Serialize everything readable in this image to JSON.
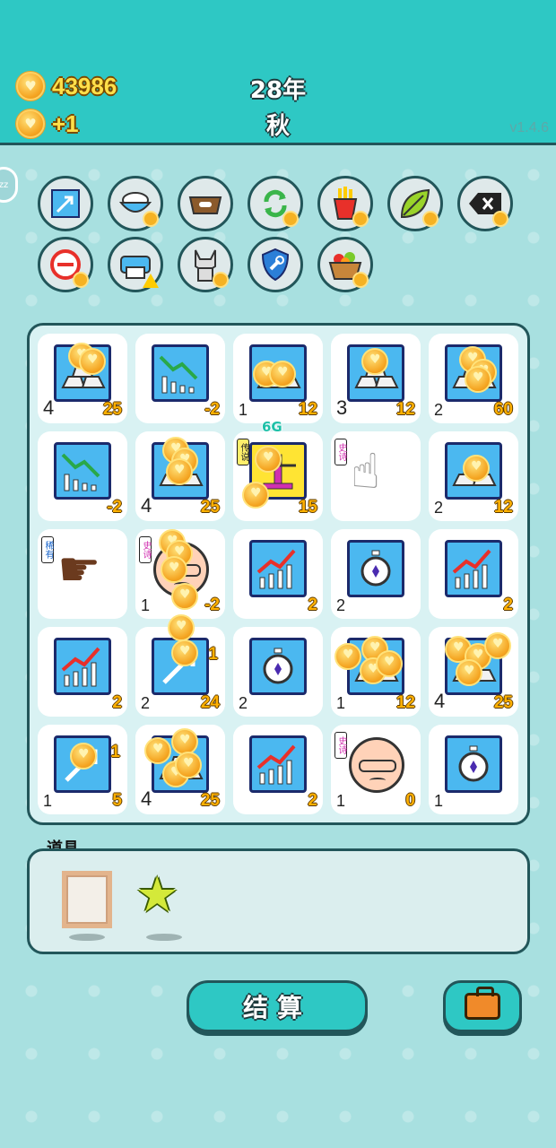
{
  "header": {
    "coins": "43986",
    "income": "+1",
    "year": "28年",
    "season": "秋",
    "version": "v1.4.6"
  },
  "side_tab": "zz",
  "skills_row1": [
    {
      "icon": "arrow-up-right-icon"
    },
    {
      "icon": "rice-bowl-icon"
    },
    {
      "icon": "dog-food-icon"
    },
    {
      "icon": "refresh-icon"
    },
    {
      "icon": "fries-icon"
    },
    {
      "icon": "leaf-icon"
    },
    {
      "icon": "delete-key-icon"
    }
  ],
  "skills_row2": [
    {
      "icon": "minus-circle-icon"
    },
    {
      "icon": "printer-icon"
    },
    {
      "icon": "dog-icon"
    },
    {
      "icon": "wrench-shield-icon"
    },
    {
      "icon": "fruit-basket-icon"
    }
  ],
  "board": [
    [
      {
        "icon": "silver-bars-icon",
        "count": "4",
        "value": "25"
      },
      {
        "icon": "chart-down-icon",
        "count": "",
        "value": "-2"
      },
      {
        "icon": "silver-bars-icon",
        "count": "1",
        "value": "12"
      },
      {
        "icon": "silver-bars-icon",
        "count": "3",
        "value": "12"
      },
      {
        "icon": "silver-bars-icon",
        "count": "2",
        "value": "60"
      }
    ],
    [
      {
        "icon": "chart-down-icon",
        "count": "",
        "value": "-2"
      },
      {
        "icon": "silver-bars-icon",
        "count": "4",
        "value": "25"
      },
      {
        "icon": "golden-scale-icon",
        "count": "",
        "value": "15",
        "tag": "传说",
        "super": "6G"
      },
      {
        "icon": "pointing-hand-icon",
        "count": "",
        "value": "",
        "tag": "史诗"
      },
      {
        "icon": "silver-bars-icon",
        "count": "2",
        "value": "12"
      }
    ],
    [
      {
        "icon": "brown-hand-icon",
        "count": "",
        "value": "",
        "tag": "稀有"
      },
      {
        "icon": "old-man-icon",
        "count": "1",
        "value": "-2",
        "tag": "史诗"
      },
      {
        "icon": "chart-up-icon",
        "count": "",
        "value": "2"
      },
      {
        "icon": "stopwatch-icon",
        "count": "2",
        "value": ""
      },
      {
        "icon": "chart-up-icon",
        "count": "",
        "value": "2"
      }
    ],
    [
      {
        "icon": "chart-up-icon",
        "count": "",
        "value": "2"
      },
      {
        "icon": "arrow-up-right-icon",
        "count": "2",
        "value": "24"
      },
      {
        "icon": "stopwatch-icon",
        "count": "2",
        "value": ""
      },
      {
        "icon": "silver-bars-icon",
        "count": "1",
        "value": "12"
      },
      {
        "icon": "silver-bars-icon",
        "count": "4",
        "value": "25"
      }
    ],
    [
      {
        "icon": "arrow-up-right-icon",
        "count": "1",
        "value": "5"
      },
      {
        "icon": "silver-bars-icon",
        "count": "4",
        "value": "25"
      },
      {
        "icon": "chart-up-icon",
        "count": "",
        "value": "2"
      },
      {
        "icon": "old-man-icon",
        "count": "1",
        "value": "0",
        "tag": "史诗"
      },
      {
        "icon": "stopwatch-icon",
        "count": "1",
        "value": ""
      }
    ]
  ],
  "tile_overlays": {
    "r3c1": "1",
    "r4c0": "1"
  },
  "items": {
    "title": "道具",
    "list": [
      {
        "icon": "picture-frame-icon"
      },
      {
        "icon": "star-icon"
      }
    ]
  },
  "buttons": {
    "settle": "结算",
    "bag_icon": "briefcase-icon"
  },
  "colors": {
    "topbar": "#2ec8c4",
    "background": "#a8e0e0",
    "coin": "#f5a623",
    "value_text": "#ffb000",
    "outline": "#22565a"
  }
}
